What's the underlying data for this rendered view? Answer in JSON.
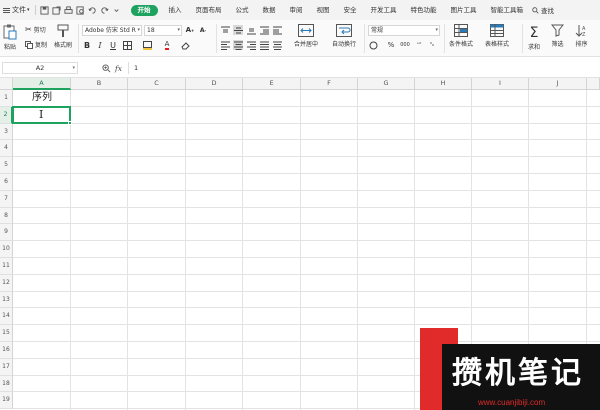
{
  "menubar": {
    "file_label": "文件",
    "tabs": [
      {
        "label": "开始",
        "active": true
      },
      {
        "label": "插入"
      },
      {
        "label": "页面布局"
      },
      {
        "label": "公式"
      },
      {
        "label": "数据"
      },
      {
        "label": "审阅"
      },
      {
        "label": "视图"
      },
      {
        "label": "安全"
      },
      {
        "label": "开发工具"
      },
      {
        "label": "特色功能"
      },
      {
        "label": "图片工具"
      },
      {
        "label": "智能工具箱"
      }
    ],
    "search_label": "查找"
  },
  "ribbon": {
    "paste": "粘贴",
    "cut": "剪切",
    "copy": "复制",
    "format_painter": "格式刷",
    "font_name": "Adobe 仿宋 Std R",
    "font_size": "18",
    "merge_center": "合并居中",
    "wrap_text": "自动换行",
    "number_format": "常规",
    "conditional_format": "条件格式",
    "table_style": "表格样式",
    "sum": "求和",
    "filter": "筛选",
    "sort": "排序",
    "bold": "B",
    "italic": "I",
    "underline": "U",
    "percent": "%",
    "thousands": "000"
  },
  "formulabar": {
    "cell_ref": "A2",
    "fx": "fx",
    "content": "1"
  },
  "grid": {
    "columns": [
      "A",
      "B",
      "C",
      "D",
      "E",
      "F",
      "G",
      "H",
      "I",
      "J"
    ],
    "rows": [
      "1",
      "2",
      "3",
      "4",
      "5",
      "6",
      "7",
      "8",
      "9",
      "10",
      "11",
      "12",
      "13",
      "14",
      "15",
      "16",
      "17",
      "18",
      "19"
    ],
    "cells": {
      "A1": "序列",
      "A2": "I"
    },
    "selected_column": "A",
    "selected_row": "2"
  },
  "watermark": {
    "main": "攒机笔记",
    "url": "www.cuanjibiji.com"
  },
  "colors": {
    "accent": "#1ea260",
    "watermark_red": "#e12a2a"
  }
}
